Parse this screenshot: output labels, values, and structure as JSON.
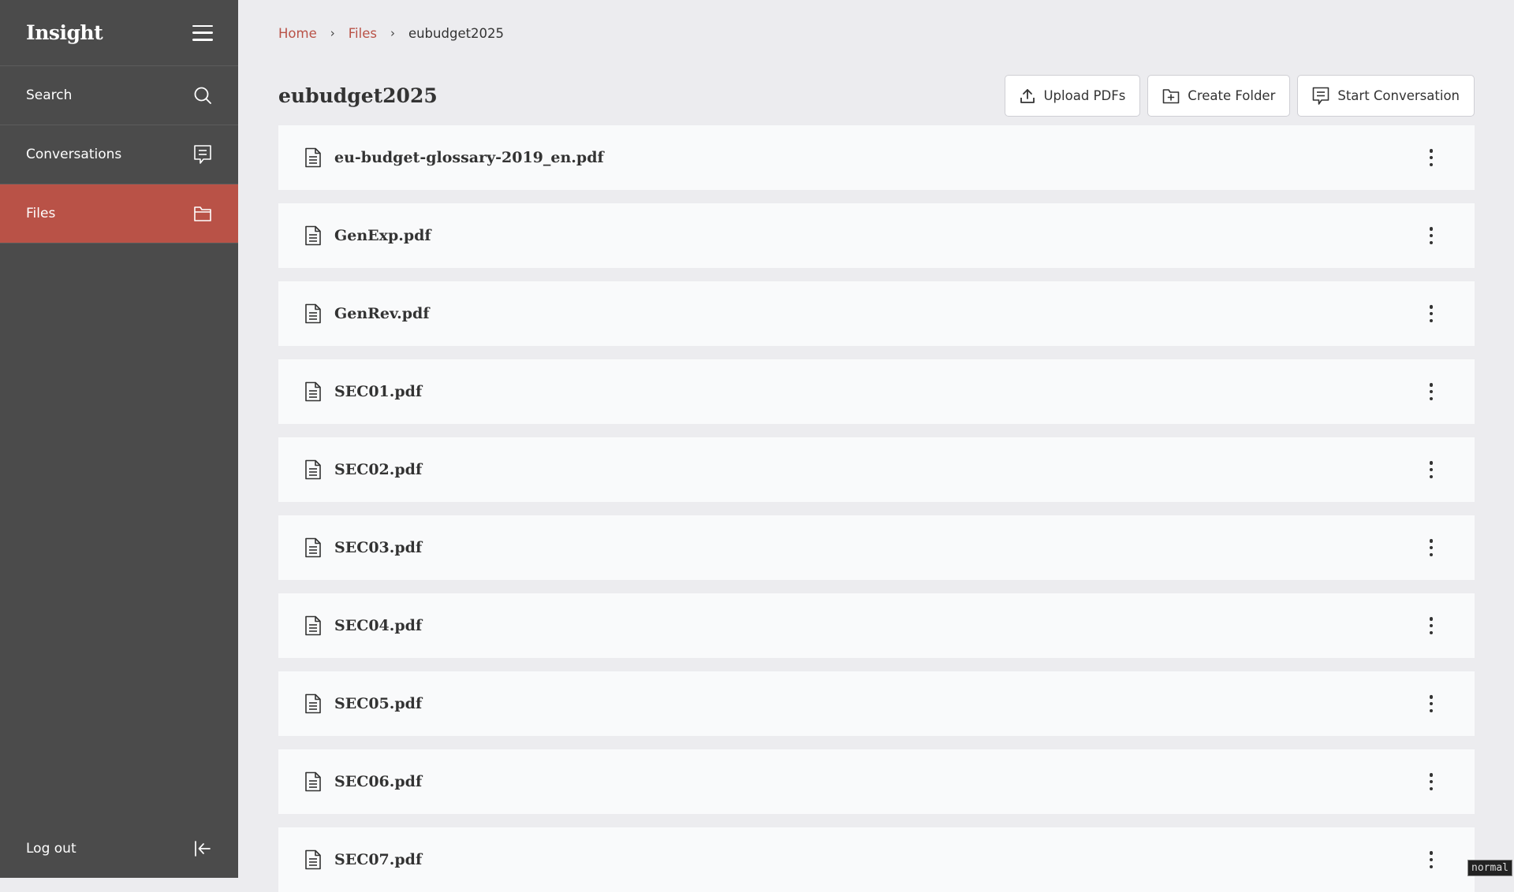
{
  "app": {
    "brand": "Insight"
  },
  "sidebar": {
    "items": [
      {
        "label": "Search",
        "icon": "search-icon"
      },
      {
        "label": "Conversations",
        "icon": "conversation-icon"
      },
      {
        "label": "Files",
        "icon": "folder-icon",
        "active": true
      }
    ],
    "logout_label": "Log out"
  },
  "breadcrumb": {
    "home": "Home",
    "files": "Files",
    "current": "eubudget2025",
    "separator": "›"
  },
  "header": {
    "title": "eubudget2025",
    "upload_label": "Upload PDFs",
    "create_folder_label": "Create Folder",
    "start_conversation_label": "Start Conversation"
  },
  "files": [
    {
      "name": "eu-budget-glossary-2019_en.pdf"
    },
    {
      "name": "GenExp.pdf"
    },
    {
      "name": "GenRev.pdf"
    },
    {
      "name": "SEC01.pdf"
    },
    {
      "name": "SEC02.pdf"
    },
    {
      "name": "SEC03.pdf"
    },
    {
      "name": "SEC04.pdf"
    },
    {
      "name": "SEC05.pdf"
    },
    {
      "name": "SEC06.pdf"
    },
    {
      "name": "SEC07.pdf"
    }
  ],
  "status": {
    "mode": "normal"
  },
  "colors": {
    "accent": "#b95247",
    "sidebar_bg": "#4b4b4b",
    "page_bg": "#ececef",
    "row_bg": "#f9fafb"
  }
}
